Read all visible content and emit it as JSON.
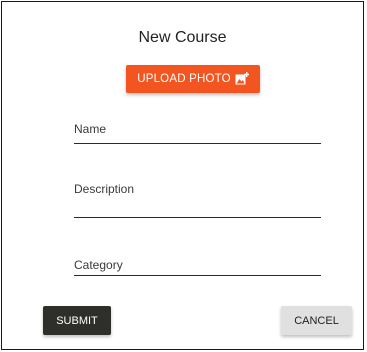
{
  "dialog": {
    "title": "New Course",
    "upload_button_label": "UPLOAD PHOTO",
    "upload_icon": "add-photo-icon"
  },
  "form": {
    "fields": [
      {
        "label": "Name",
        "value": ""
      },
      {
        "label": "Description",
        "value": ""
      },
      {
        "label": "Category",
        "value": ""
      }
    ]
  },
  "actions": {
    "submit_label": "SUBMIT",
    "cancel_label": "CANCEL"
  },
  "colors": {
    "accent": "#f2551f",
    "submit_bg": "#2e2f2b",
    "cancel_bg": "#e0e0e0"
  }
}
